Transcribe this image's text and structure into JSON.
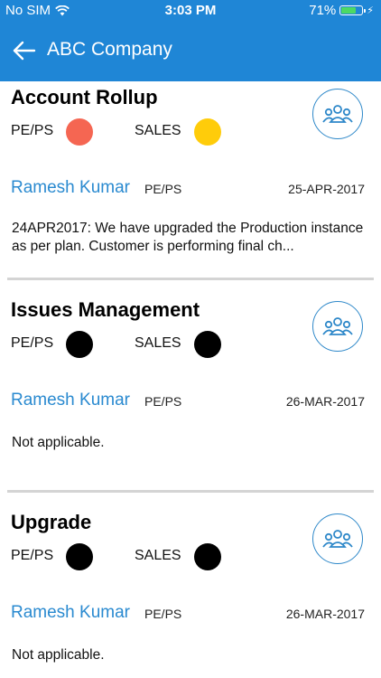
{
  "status_bar": {
    "carrier": "No SIM",
    "time": "3:03 PM",
    "battery": "71%",
    "battery_level": 0.71
  },
  "header": {
    "title": "ABC Company",
    "back_icon": "arrow-left-icon"
  },
  "colors": {
    "primary": "#1f86d6",
    "link": "#2a8ad0",
    "red": "#f56652",
    "yellow": "#ffcc0a",
    "black": "#000000"
  },
  "cards": [
    {
      "title": "Account Rollup",
      "status1_label": "PE/PS",
      "status1_color": "red",
      "status2_label": "SALES",
      "status2_color": "yellow",
      "owner": "Ramesh Kumar",
      "role": "PE/PS",
      "date": "25-APR-2017",
      "note": "24APR2017: We have upgraded the Production instance as per plan. Customer is performing final ch..."
    },
    {
      "title": "Issues Management",
      "status1_label": "PE/PS",
      "status1_color": "black",
      "status2_label": "SALES",
      "status2_color": "black",
      "owner": "Ramesh Kumar",
      "role": "PE/PS",
      "date": "26-MAR-2017",
      "note": "Not applicable."
    },
    {
      "title": "Upgrade",
      "status1_label": "PE/PS",
      "status1_color": "black",
      "status2_label": "SALES",
      "status2_color": "black",
      "owner": "Ramesh Kumar",
      "role": "PE/PS",
      "date": "26-MAR-2017",
      "note": "Not applicable."
    }
  ]
}
